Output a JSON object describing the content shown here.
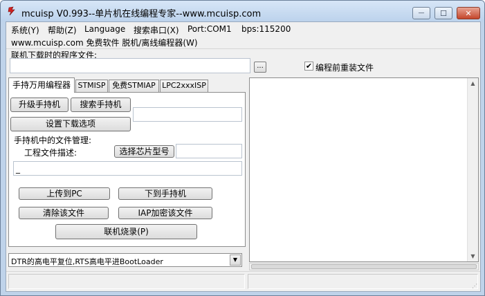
{
  "window": {
    "title": "mcuisp V0.993--单片机在线编程专家--www.mcuisp.com",
    "min_glyph": "—",
    "max_glyph": "☐",
    "close_glyph": "✕"
  },
  "menu": [
    {
      "label": "系统(Y)"
    },
    {
      "label": "帮助(Z)"
    },
    {
      "label": "Language"
    },
    {
      "label": "搜索串口(X)"
    },
    {
      "label": "Port:COM1"
    },
    {
      "label": "bps:115200"
    }
  ],
  "subtitle": "www.mcuisp.com 免费软件 脱机/离线编程器(W)",
  "file": {
    "label": "联机下载时的程序文件:",
    "value": "",
    "browse_label": "...",
    "reload_checked": true,
    "check_mark": "✔",
    "reload_label": "编程前重装文件"
  },
  "tabs": [
    {
      "label": "手持万用编程器",
      "active": true
    },
    {
      "label": "STMISP",
      "active": false
    },
    {
      "label": "免费STMIAP",
      "active": false
    },
    {
      "label": "LPC2xxxISP",
      "active": false
    }
  ],
  "panel": {
    "upgrade_btn": "升级手持机",
    "search_btn": "搜索手持机",
    "device_field": "",
    "settings_btn": "设置下载选项",
    "file_mgmt_label": "手持机中的文件管理:",
    "proj_desc_label": "工程文件描述:",
    "select_chip_btn": "选择芯片型号",
    "chip_field": "",
    "desc_field": "_",
    "upload_btn": "上传到PC",
    "download_btn": "下到手持机",
    "delete_btn": "清除该文件",
    "iap_btn": "IAP加密该文件",
    "burn_btn": "联机烧录(P)"
  },
  "combo": {
    "value": "DTR的高电平复位,RTS高电平进BootLoader",
    "arrow": "▼"
  },
  "output": {
    "text": "",
    "up_arrow": "▲",
    "down_arrow": "▼"
  },
  "status": {
    "left": "",
    "right": "",
    "grip": "⋰"
  },
  "colors": {
    "title_bg": "#bcd2ec",
    "close_btn": "#c4452b",
    "dialog_bg": "#f0f0f0"
  }
}
